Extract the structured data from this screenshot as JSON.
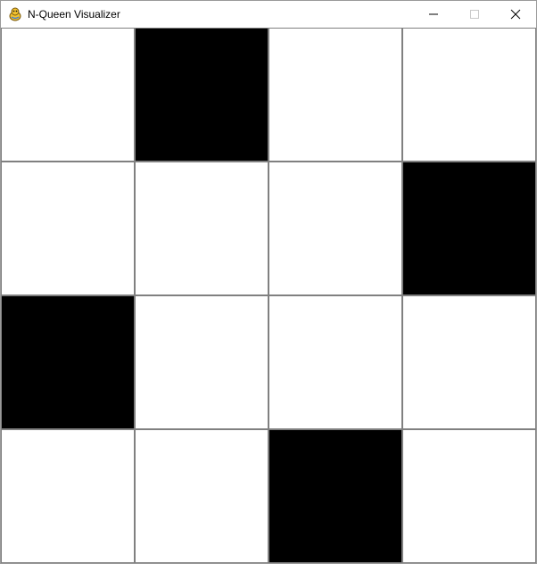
{
  "window": {
    "title": "N-Queen Visualizer",
    "app_icon": "pygame-snake-icon",
    "controls": [
      "minimize-icon",
      "maximize-icon",
      "close-icon"
    ]
  },
  "board": {
    "n": 4,
    "queen_columns_by_row": [
      1,
      3,
      0,
      2
    ],
    "colors": {
      "empty": "#ffffff",
      "queen": "#000000",
      "grid_line": "#808080"
    }
  }
}
